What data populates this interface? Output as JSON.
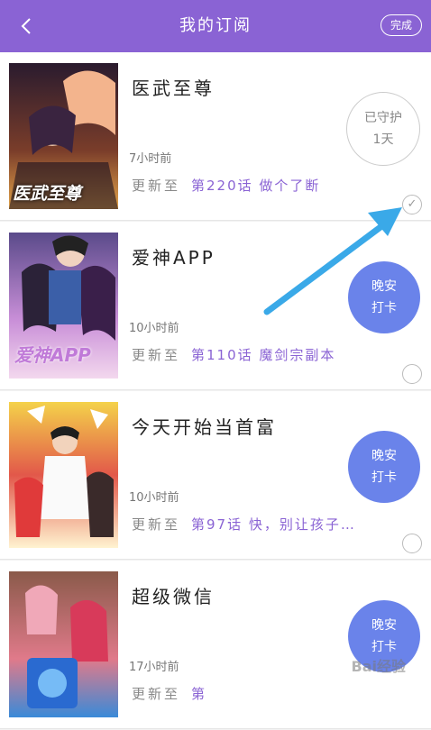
{
  "header": {
    "title": "我的订阅",
    "done_label": "完成",
    "back_icon": "chevron-left-icon"
  },
  "items": [
    {
      "name": "医武至尊",
      "time": "7小时前",
      "update_prefix": "更新至",
      "chapter": "第220话 做个了断",
      "badge_type": "guard",
      "badge_line1": "已守护",
      "badge_line2": "1天",
      "selected": true,
      "cover_text": "医武至尊",
      "cover_colors": [
        "#2a1b2e",
        "#7a3d2a",
        "#e3a44a"
      ]
    },
    {
      "name": "爱神APP",
      "time": "10小时前",
      "update_prefix": "更新至",
      "chapter": "第110话 魔剑宗副本",
      "badge_type": "checkin",
      "badge_line1": "晚安",
      "badge_line2": "打卡",
      "selected": false,
      "cover_text": "爱神APP",
      "cover_colors": [
        "#5a4a8a",
        "#c98fd8",
        "#f3d8ee"
      ]
    },
    {
      "name": "今天开始当首富",
      "time": "10小时前",
      "update_prefix": "更新至",
      "chapter": "第97话 快，别让孩子…",
      "badge_type": "checkin",
      "badge_line1": "晚安",
      "badge_line2": "打卡",
      "selected": false,
      "cover_text": "",
      "cover_colors": [
        "#f4d24a",
        "#e2584a",
        "#fff3d0"
      ]
    },
    {
      "name": "超级微信",
      "time": "17小时前",
      "update_prefix": "更新至",
      "chapter": "第",
      "badge_type": "checkin",
      "badge_line1": "晚安",
      "badge_line2": "打卡",
      "selected": false,
      "cover_text": "",
      "cover_colors": [
        "#8a5a4a",
        "#e07a8a",
        "#3a8ad8"
      ]
    }
  ],
  "annotation": {
    "arrow_color": "#3aa9e8"
  },
  "watermark": "Bai经验"
}
